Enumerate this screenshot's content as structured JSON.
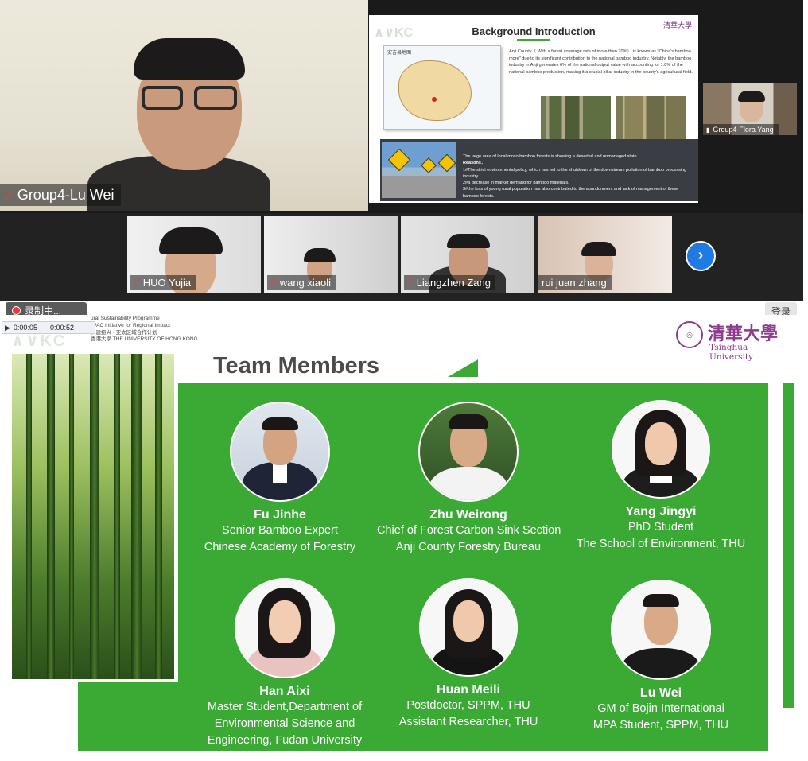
{
  "meeting": {
    "main_speaker": "Group4-Lu Wei",
    "small_speaker": "Group4-Flora Yang",
    "participants": [
      {
        "name": "HUO Yujia",
        "muted": true
      },
      {
        "name": "wang xiaoli",
        "muted": true
      },
      {
        "name": "Liangzhen Zang",
        "muted": true
      },
      {
        "name": "rui juan zhang",
        "muted": false
      }
    ],
    "next_page_icon": "chevron-right-icon",
    "recording_label": "录制中...",
    "recording_elapsed": "0:00:05",
    "recording_total": "0:00:52",
    "login_label": "登录"
  },
  "shared_slide": {
    "title": "Background Introduction",
    "logo_right": "清華大學",
    "map_label": "安吉县地图",
    "intro_text": "Anji County（ With a forest coverage rate of more than 70%） is known as \"China's bamboo more\" due to its significant contribution to the national bamboo industry. Notably, the bamboo industry in Anji generates 6% of the national output value with accounting for 1.8% of the national bamboo production, making it a crucial pillar industry in the county's agricultural field.",
    "band_lines": [
      "The large area of local moso bamboo forests is showing a deserted and unmanaged state.",
      "Reasons：",
      "1#The strict environmental policy, which has led to the shutdown of the downstream pollution of bamboo processing industry.",
      "2#a decrease in market demand for bamboo materials.",
      "3#the loss of young rural population has also contributed to the abandonment and lack of management of these bamboo forests."
    ]
  },
  "team_slide": {
    "logo_left_lines": [
      "ural Sustainability Programme",
      "sPAC Initiative for Regional Impact",
      "乡建振兴 · 亚太区域合作计划",
      "香港大學 THE UNIVERSITY OF HONG KONG"
    ],
    "logo_right_cn": "清華大學",
    "logo_right_en": "Tsinghua University",
    "title": "Team Members",
    "members": [
      {
        "name": "Fu Jinhe",
        "lines": [
          "Senior Bamboo Expert",
          "Chinese Academy of Forestry"
        ]
      },
      {
        "name": "Zhu Weirong",
        "lines": [
          "Chief of Forest Carbon Sink Section",
          "Anji County Forestry Bureau"
        ]
      },
      {
        "name": "Yang Jingyi",
        "lines": [
          "PhD Student",
          "The School of Environment, THU"
        ]
      },
      {
        "name": "Han Aixi",
        "lines": [
          "Master Student,Department of",
          "Environmental Science and",
          "Engineering, Fudan University"
        ]
      },
      {
        "name": "Huan Meili",
        "lines": [
          "Postdoctor, SPPM, THU",
          "Assistant Researcher, THU"
        ]
      },
      {
        "name": "Lu Wei",
        "lines": [
          "GM of Bojin International",
          "MPA Student, SPPM, THU"
        ]
      }
    ]
  },
  "colors": {
    "slide_green": "#3aaa35",
    "tsinghua_purple": "#8d3b8e",
    "next_button_blue": "#1f7be3",
    "muted_red": "#e0443e"
  }
}
